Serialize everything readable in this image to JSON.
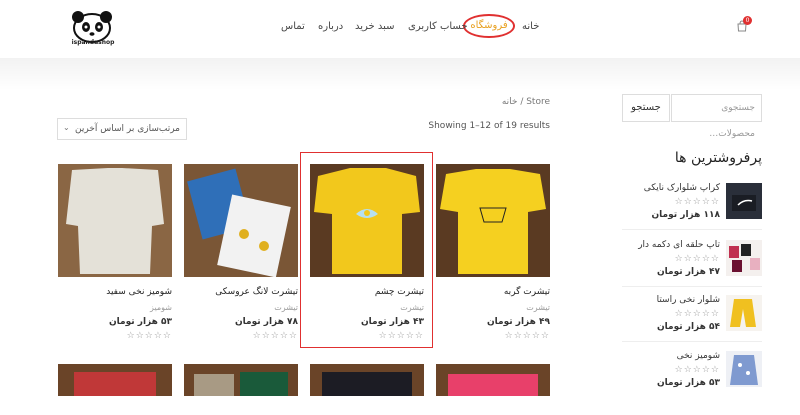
{
  "header": {
    "logo_text": "ispandashop",
    "cart_count": "0",
    "nav": {
      "home": "خانه",
      "shop": "فروشگاه",
      "account": "حساب کاربری",
      "cart": "سبد خرید",
      "about": "درباره",
      "contact": "تماس"
    }
  },
  "sidebar": {
    "search_placeholder": "جستجوی محصولات…",
    "search_button": "جستجو",
    "best_sellers_title": "پرفروشترین ها",
    "items": [
      {
        "name": "کراپ شلوارک نایکی",
        "price": "۱۱۸ هزار تومان",
        "stars": "☆☆☆☆☆"
      },
      {
        "name": "تاپ حلقه ای دکمه دار",
        "price": "۴۷ هزار تومان",
        "stars": "☆☆☆☆☆"
      },
      {
        "name": "شلوار نخی راستا",
        "price": "۵۴ هزار تومان",
        "stars": "☆☆☆☆☆"
      },
      {
        "name": "شومیز نخی",
        "price": "۵۳ هزار تومان",
        "stars": "☆☆☆☆☆"
      }
    ]
  },
  "main": {
    "breadcrumb": "خانه / Store",
    "results_text": "Showing 1–12 of 19 results",
    "sort_label": "مرتب‌سازی بر اساس آخرین",
    "products": [
      {
        "name": "تیشرت گربه",
        "category": "تیشرت",
        "price": "۴۹ هزار تومان",
        "stars": "☆☆☆☆☆"
      },
      {
        "name": "تیشرت چشم",
        "category": "تیشرت",
        "price": "۴۳ هزار تومان",
        "stars": "☆☆☆☆☆"
      },
      {
        "name": "تیشرت لانگ عروسکی",
        "category": "تیشرت",
        "price": "۷۸ هزار تومان",
        "stars": "☆☆☆☆☆"
      },
      {
        "name": "شومیز نخی سفید",
        "category": "شومیز",
        "price": "۵۳ هزار تومان",
        "stars": "☆☆☆☆☆"
      }
    ]
  },
  "colors": {
    "accent_orange": "#e8a020",
    "highlight_red": "#e03030"
  }
}
